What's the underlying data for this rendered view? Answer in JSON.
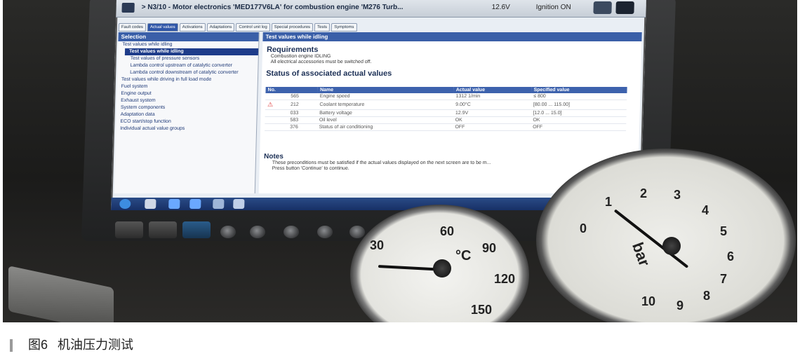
{
  "screen": {
    "title_path": "> N3/10 - Motor electronics 'MED177V6LA' for combustion engine 'M276 Turb...",
    "voltage": "12.6V",
    "ignition": "Ignition ON",
    "tabs": [
      "Fault codes",
      "Actual values",
      "Activations",
      "Adaptations",
      "Control unit log",
      "Special procedures",
      "Tests",
      "Symptoms"
    ],
    "active_tab_index": 1,
    "sidebar": {
      "header": "Selection",
      "items": [
        {
          "label": "Test values while idling",
          "style": "normal"
        },
        {
          "label": "Test values while idling",
          "style": "active"
        },
        {
          "label": "Test values of pressure sensors",
          "style": "sub"
        },
        {
          "label": "Lambda control upstream of catalytic converter",
          "style": "sub"
        },
        {
          "label": "Lambda control downstream of catalytic converter",
          "style": "sub"
        },
        {
          "label": "Test values while driving in full load mode",
          "style": "normal"
        },
        {
          "label": "Fuel system",
          "style": "normal"
        },
        {
          "label": "Engine output",
          "style": "normal"
        },
        {
          "label": "Exhaust system",
          "style": "normal"
        },
        {
          "label": "System components",
          "style": "normal"
        },
        {
          "label": "Adaptation data",
          "style": "normal"
        },
        {
          "label": "ECO start/stop function",
          "style": "normal"
        },
        {
          "label": "Individual actual value groups",
          "style": "normal"
        }
      ]
    },
    "content": {
      "header": "Test values while idling",
      "requirements_title": "Requirements",
      "requirements": [
        "Combustion engine IDLING",
        "All electrical accessories must be switched off."
      ],
      "status_title": "Status of associated actual values",
      "table_headers": [
        "No.",
        "Name",
        "Actual value",
        "Specified value"
      ],
      "rows": [
        {
          "no": "565",
          "name": "Engine speed",
          "actual": "1312 1/min",
          "specified": "≤ 800",
          "warn": false
        },
        {
          "no": "212",
          "name": "Coolant temperature",
          "actual": "9.00°C",
          "specified": "[80.00 ... 115.00]",
          "warn": true
        },
        {
          "no": "033",
          "name": "Battery voltage",
          "actual": "12.9V",
          "specified": "[12.0 ... 15.0]",
          "warn": false
        },
        {
          "no": "583",
          "name": "Oil level",
          "actual": "OK",
          "specified": "OK",
          "warn": false
        },
        {
          "no": "376",
          "name": "Status of air conditioning",
          "actual": "OFF",
          "specified": "OFF",
          "warn": false
        }
      ],
      "notes_title": "Notes",
      "notes": [
        "These preconditions must be satisfied if the actual values displayed on the next screen are to be m...",
        "Press button 'Continue' to continue."
      ]
    }
  },
  "gauge_temp": {
    "unit": "°C",
    "labels": [
      "30",
      "60",
      "90",
      "120",
      "150"
    ],
    "reading_c": 0
  },
  "gauge_pressure": {
    "unit": "bar",
    "labels": [
      "0",
      "1",
      "2",
      "3",
      "4",
      "5",
      "6",
      "7",
      "8",
      "9",
      "10"
    ],
    "reading_bar": 1.5
  },
  "caption": {
    "figure": "图6",
    "text": "机油压力测试"
  },
  "colors": {
    "screen_accent": "#3a5fa8",
    "warning": "#dd3333",
    "taskbar": "#1f3a70"
  }
}
